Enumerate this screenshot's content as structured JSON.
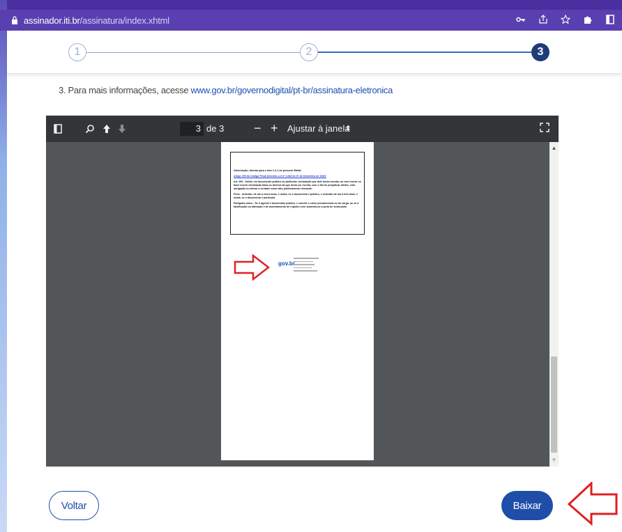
{
  "browser": {
    "url_host": "assinador.iti.br",
    "url_path": "/assinatura/index.xhtml"
  },
  "stepper": {
    "steps": [
      "1",
      "2",
      "3"
    ],
    "current_step": 3
  },
  "info": {
    "text": "3. Para mais informações, acesse ",
    "link": "www.gov.br/governodigital/pt-br/assinatura-eletronica"
  },
  "pdf_viewer": {
    "current_page": "3",
    "total_pages_label": "de 3",
    "zoom_minus": "−",
    "zoom_plus": "+",
    "zoom_option": "Ajustar à janela",
    "document": {
      "observation": "Observação: Atentar para o item 2.4.1 do presente Edital.",
      "article_link": "Artigo 299 do Código Penal (Decreto-Lei nº 2.848 de 07 de Dezembro de 1940)",
      "paragraph1": "Art. 299 - Omitir, em documento público ou particular, declaração que dele devia constar, ou nele inserir ou fazer inserir declaração falsa ou diversa da que devia ser escrita, com o fim de prejudicar direito, criar obrigação ou alterar a verdade sobre fato juridicamente relevante:",
      "paragraph2": "Pena - reclusão, de um a cinco anos, e multa, se o documento é público, e reclusão de um a três anos, e multa, se o documento é particular.",
      "paragraph3": "Parágrafo único - Se o agente é funcionário público, e comete o crime prevalecendo-se do cargo, ou se a falsificação ou alteração é de assentamento de registro civil, aumenta-se a pena de sexta parte.",
      "logo_text": "gov.br"
    }
  },
  "buttons": {
    "back": "Voltar",
    "download": "Baixar"
  },
  "colors": {
    "primary": "#1f4ea8",
    "step_active": "#1f3b78",
    "annotation_arrow": "#e02020"
  }
}
